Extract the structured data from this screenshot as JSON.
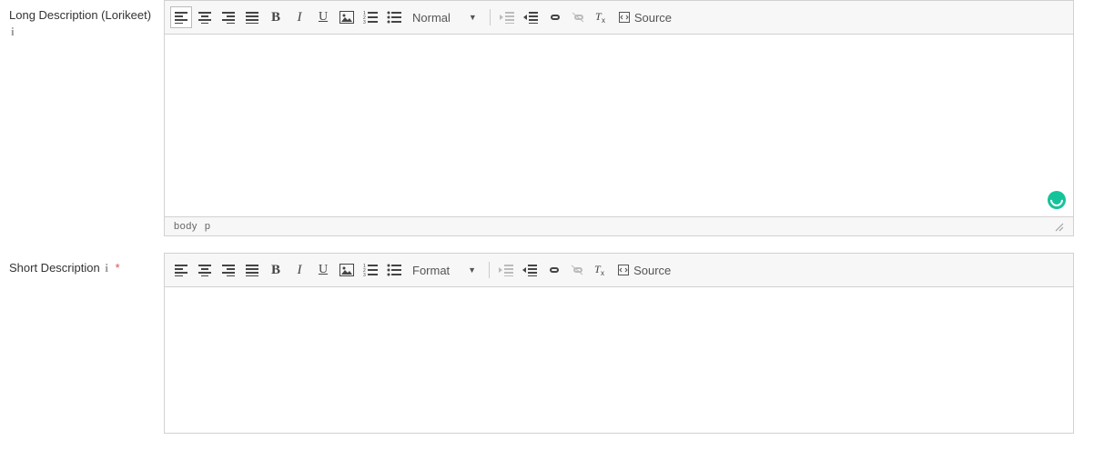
{
  "editor1": {
    "label": "Long Description (Lorikeet)",
    "format_label": "Normal",
    "source_label": "Source",
    "path_body": "body",
    "path_p": "p"
  },
  "editor2": {
    "label": "Short Description",
    "format_label": "Format",
    "source_label": "Source"
  },
  "icons": {
    "align_left": "align-left-icon",
    "align_center": "align-center-icon",
    "align_right": "align-right-icon",
    "justify": "align-justify-icon",
    "bold": "bold-icon",
    "italic": "italic-icon",
    "underline": "underline-icon",
    "image": "image-icon",
    "numbered_list": "numbered-list-icon",
    "bullet_list": "bullet-list-icon",
    "outdent": "outdent-icon",
    "indent": "indent-icon",
    "link": "link-icon",
    "unlink": "unlink-icon",
    "remove_format": "remove-format-icon",
    "source": "source-icon"
  }
}
